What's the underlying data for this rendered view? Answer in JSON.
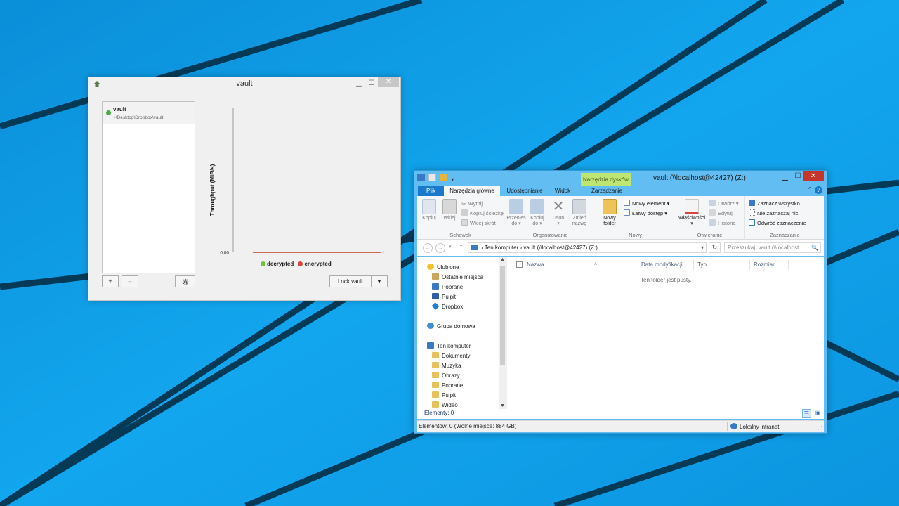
{
  "colors": {
    "desktop": "#0f9ee6",
    "decrypted": "#6fc43a",
    "encrypted": "#d9453b",
    "vault_active": "#3cb23c",
    "explorer_accent": "#1979ca",
    "context_tab": "#bde672"
  },
  "vault_window": {
    "title": "vault",
    "title_icon": "vault-app-icon",
    "vaults": [
      {
        "name": "vault",
        "path": "~\\Desktop\\Dropbox\\vault"
      }
    ],
    "add_label": "+",
    "remove_label": "–",
    "settings_icon": "gear-icon",
    "lock_label": "Lock vault",
    "lock_menu_icon": "triangle-down-icon"
  },
  "chart_data": {
    "type": "line",
    "ylabel": "Throughput (MiB/s)",
    "yticks": [
      "0.00"
    ],
    "ylim": [
      0,
      1
    ],
    "grid": false,
    "legend_position": "bottom",
    "series": [
      {
        "name": "decrypted",
        "values": [
          0,
          0
        ]
      },
      {
        "name": "encrypted",
        "values": [
          0,
          0
        ]
      }
    ]
  },
  "explorer_window": {
    "title": "vault (\\\\localhost@42427) (Z:)",
    "context_tab_group": "Narzędzia dysków",
    "tabs": [
      "Plik",
      "Narzędzia główne",
      "Udostępnianie",
      "Widok",
      "Zarządzanie"
    ],
    "ribbon": {
      "schowek": {
        "label": "Schowek",
        "copy": "Kopiuj",
        "paste": "Wklej",
        "cut": "Wytnij",
        "copy_path": "Kopiuj ścieżkę",
        "paste_shortcut": "Wklej skrót"
      },
      "organizowanie": {
        "label": "Organizowanie",
        "move_l1": "Przenieś",
        "move_l2": "do ▾",
        "copyto_l1": "Kopiuj",
        "copyto_l2": "do ▾",
        "delete_l1": "Usuń",
        "delete_l2": "▾",
        "rename_l1": "Zmień",
        "rename_l2": "nazwę"
      },
      "nowy": {
        "label": "Nowy",
        "new_folder_l1": "Nowy",
        "new_folder_l2": "folder",
        "new_item": "Nowy element ▾",
        "easy_access": "Łatwy dostęp ▾"
      },
      "otwieranie": {
        "label": "Otwieranie",
        "properties_l1": "Właściwości",
        "properties_l2": "▾",
        "open": "Otwórz ▾",
        "edit": "Edytuj",
        "history": "Historia"
      },
      "zaznaczanie": {
        "label": "Zaznaczanie",
        "select_all": "Zaznacz wszystko",
        "select_none": "Nie zaznaczaj nic",
        "invert": "Odwróć zaznaczenie"
      }
    },
    "address": {
      "back": "←",
      "forward": "→",
      "recent": "▾",
      "up": "↑",
      "crumb_sep": "›",
      "crumb1": "Ten komputer",
      "crumb2": "vault (\\\\localhost@42427) (Z:)",
      "dropdown": "▾",
      "refresh": "↻",
      "search_placeholder": "Przeszukaj: vault (\\\\localhost...",
      "search_icon": "🔍"
    },
    "nav": {
      "favorites": "Ulubione",
      "recent": "Ostatnie miejsca",
      "downloads": "Pobrane",
      "desktop": "Pulpit",
      "dropbox": "Dropbox",
      "homegroup": "Grupa domowa",
      "this_pc": "Ten komputer",
      "documents": "Dokumenty",
      "music": "Muzyka",
      "pictures": "Obrazy",
      "downloads2": "Pobrane",
      "desktop2": "Pulpit",
      "videos": "Wideo"
    },
    "columns": [
      "Nazwa",
      "Data modyfikacji",
      "Typ",
      "Rozmiar"
    ],
    "sort_caret": "˄",
    "empty_message": "Ten folder jest pusty.",
    "items_count": "Elementy: 0",
    "status_left": "Elementów: 0 (Wolne miejsce: 884 GB)",
    "status_zone": "Lokalny intranet",
    "ribbon_help": "?",
    "ribbon_collapse": "^"
  }
}
